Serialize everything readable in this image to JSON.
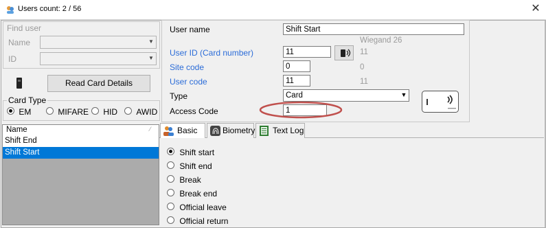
{
  "window": {
    "title": "Users count: 2 / 56"
  },
  "find": {
    "title": "Find user",
    "name_label": "Name",
    "id_label": "ID",
    "name_value": "",
    "id_value": ""
  },
  "read_card": {
    "label": "Read Card Details"
  },
  "card_type": {
    "title": "Card Type",
    "options": [
      "EM",
      "MIFARE",
      "HID",
      "AWID"
    ],
    "selected": "EM"
  },
  "user_list": {
    "header": "Name",
    "rows": [
      "Shift End",
      "Shift Start"
    ],
    "selected": "Shift Start"
  },
  "form": {
    "user_name_label": "User name",
    "user_name_value": "Shift Start",
    "wiegand_label": "Wiegand 26",
    "user_id_label": "User ID (Card number)",
    "user_id_value": "11",
    "user_id_readout": "11",
    "site_code_label": "Site code",
    "site_code_value": "0",
    "site_code_readout": "0",
    "user_code_label": "User code",
    "user_code_value": "11",
    "user_code_readout": "11",
    "type_label": "Type",
    "type_value": "Card",
    "access_code_label": "Access Code",
    "access_code_value": "1"
  },
  "tabs": [
    {
      "label": "Basic",
      "active": true
    },
    {
      "label": "Biometry",
      "active": false
    },
    {
      "label": "Text Log",
      "active": false
    }
  ],
  "basic": {
    "options": [
      "Shift start",
      "Shift end",
      "Break",
      "Break end",
      "Official leave",
      "Official return"
    ],
    "selected": "Shift start"
  },
  "colors": {
    "selection": "#0078d7",
    "annotation": "#c0504d",
    "link_label": "#2b6cd8"
  }
}
